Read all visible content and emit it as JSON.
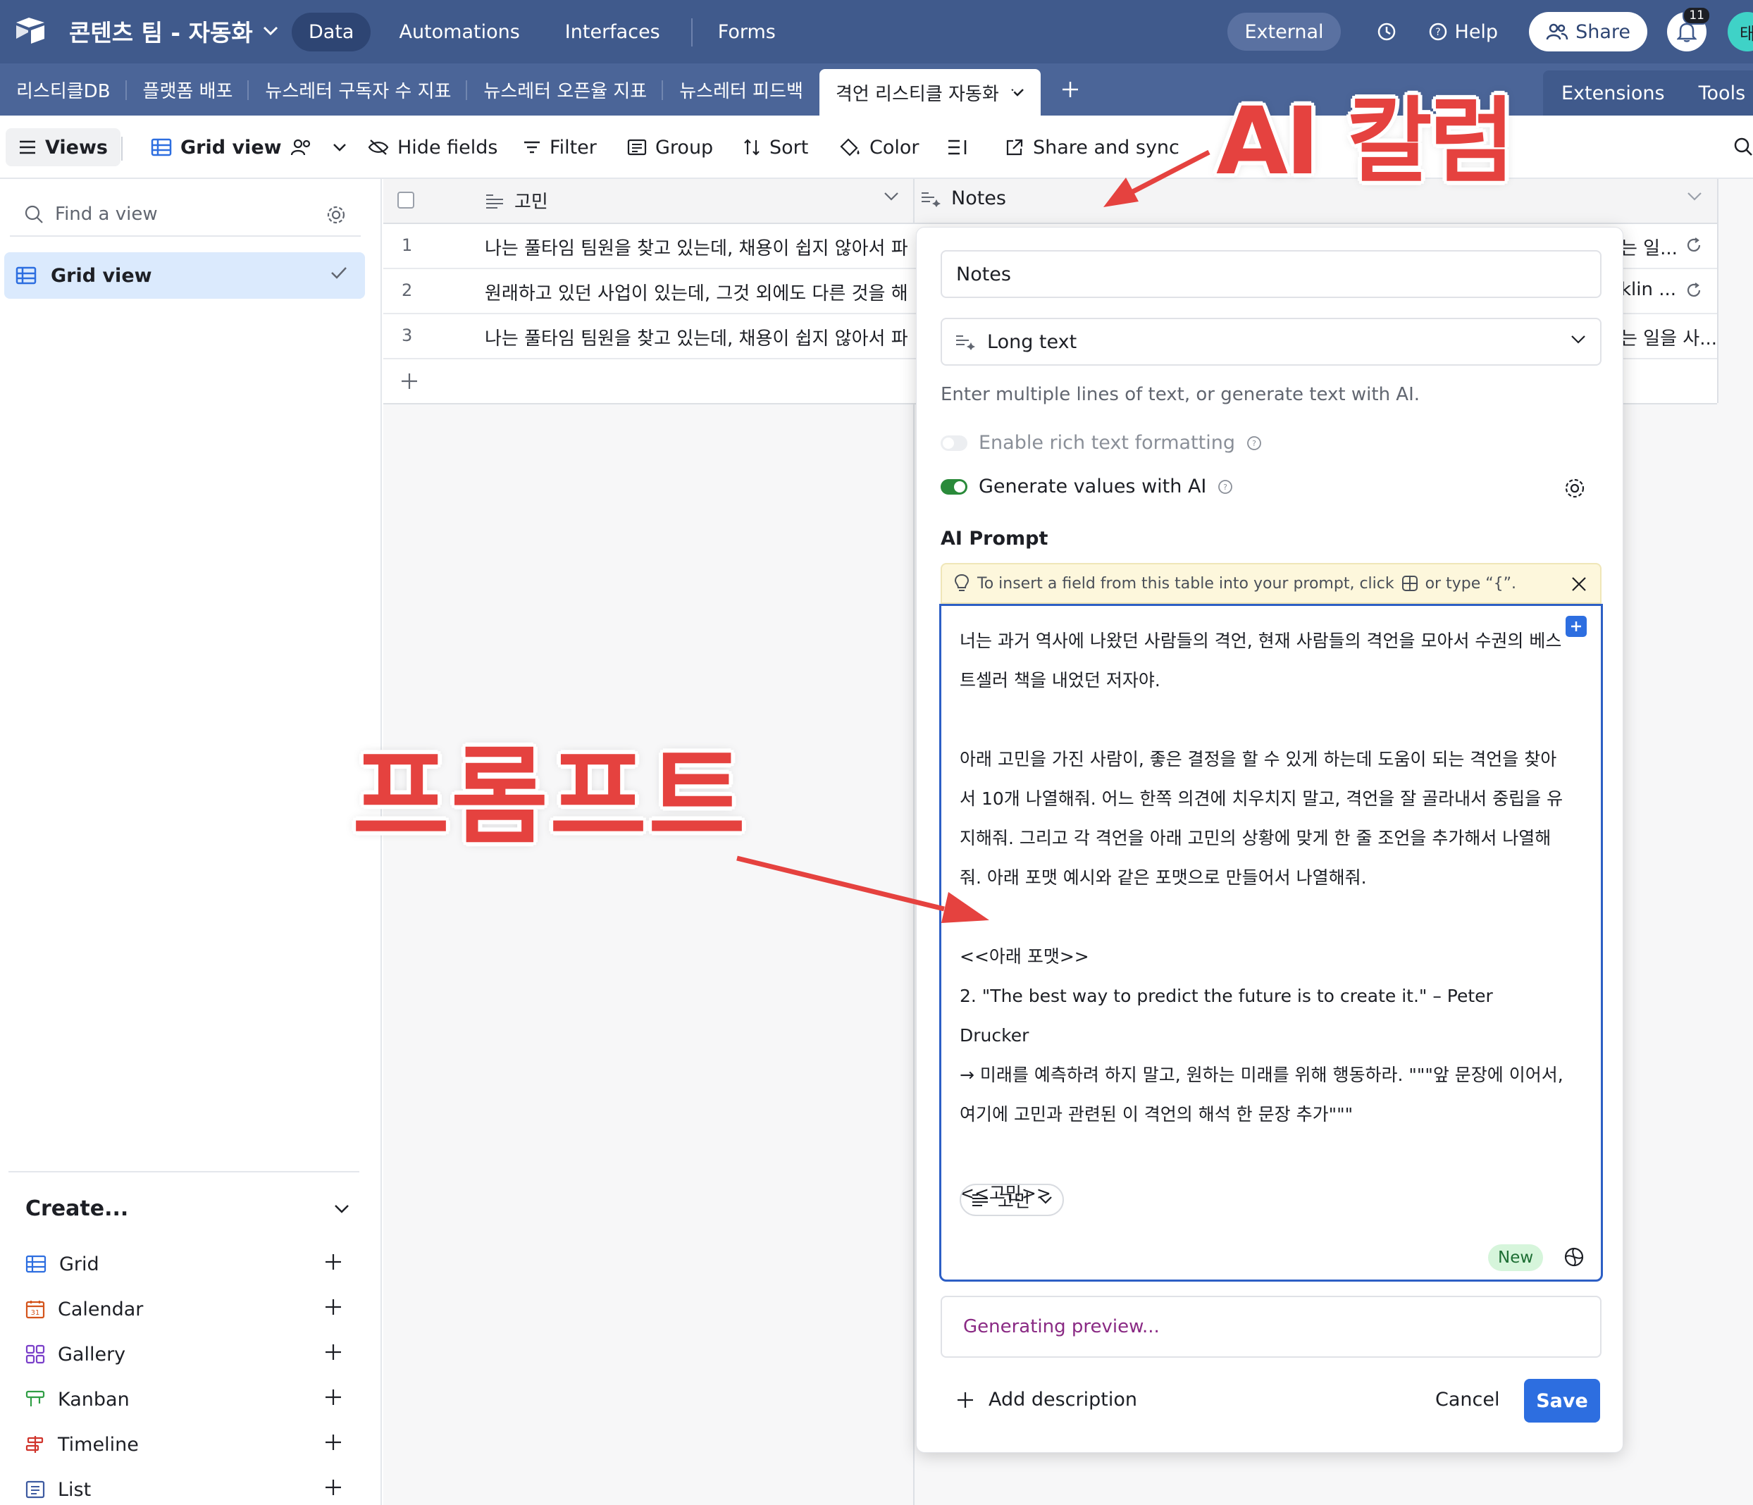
{
  "topbar": {
    "base_name": "콘텐츠 팀 - 자동화",
    "nav": [
      "Data",
      "Automations",
      "Interfaces",
      "Forms"
    ],
    "active_nav": "Data",
    "external": "External",
    "help": "Help",
    "share": "Share",
    "notif_count": "11",
    "avatar": "태"
  },
  "tabs": [
    "리스티클DB",
    "플랫폼 배포",
    "뉴스레터 구독자 수 지표",
    "뉴스레터 오픈율 지표",
    "뉴스레터 피드백"
  ],
  "active_tab": "격언 리스티클 자동화",
  "tab_right": {
    "extensions": "Extensions",
    "tools": "Tools"
  },
  "toolbar": {
    "views": "Views",
    "grid_view": "Grid view",
    "hide_fields": "Hide fields",
    "filter": "Filter",
    "group": "Group",
    "sort": "Sort",
    "color": "Color",
    "share_sync": "Share and sync"
  },
  "sidebar": {
    "find_placeholder": "Find a view",
    "grid_view": "Grid view",
    "create": "Create...",
    "create_items": [
      "Grid",
      "Calendar",
      "Gallery",
      "Kanban",
      "Timeline",
      "List"
    ]
  },
  "grid": {
    "col1": "고민",
    "col2": "Notes",
    "rows": [
      {
        "num": "1",
        "text": "나는 풀타임 팀원을 찾고 있는데, 채용이 쉽지 않아서 파...",
        "right": "는 일..."
      },
      {
        "num": "2",
        "text": "원래하고 있던 사업이 있는데, 그것 외에도 다른 것을 해 ...",
        "right": "klin ..."
      },
      {
        "num": "3",
        "text": "나는 풀타임 팀원을 찾고 있는데, 채용이 쉽지 않아서 파...",
        "right": "는 일을 사..."
      }
    ]
  },
  "panel": {
    "field_name": "Notes",
    "field_type": "Long text",
    "help": "Enter multiple lines of text, or generate text with AI.",
    "rich_text": "Enable rich text formatting",
    "gen_ai": "Generate values with AI",
    "ai_prompt_title": "AI Prompt",
    "hint_a": "To insert a field from this table into your prompt, click",
    "hint_b": "or type “{”.",
    "prompt": "너는 과거 역사에 나왔던 사람들의 격언, 현재 사람들의 격언을 모아서 수권의 베스트셀러 책을 내었던 저자야.\n\n아래 고민을 가진 사람이, 좋은 결정을 할 수 있게 하는데 도움이 되는 격언을 찾아서 10개 나열해줘. 어느 한쪽 의견에 치우치지 말고, 격언을 잘 골라내서 중립을 유지해줘. 그리고 각 격언을 아래 고민의 상황에 맞게 한 줄 조언을 추가해서 나열해줘. 아래 포맷 예시와 같은 포맷으로 만들어서 나열해줘.\n\n<<아래 포맷>>\n2. \"The best way to predict the future is to create it.\" – Peter Drucker\n→ 미래를 예측하려 하지 말고, 원하는 미래를 위해 행동하라. \"\"\"앞 문장에 이어서, 여기에 고민과 관련된 이 격언의 해석 한 문장 추가\"\"\"\n\n<<고민>>",
    "chip": "고민",
    "new": "New",
    "preview": "Generating preview...",
    "add_description": "Add description",
    "cancel": "Cancel",
    "save": "Save"
  },
  "annotations": {
    "ai_column": "AI 칼럼",
    "prompt": "프롬프트"
  },
  "colors": {
    "topbar": "#405a8c",
    "accent": "#2d6ee0",
    "annotation": "#e5423f"
  }
}
